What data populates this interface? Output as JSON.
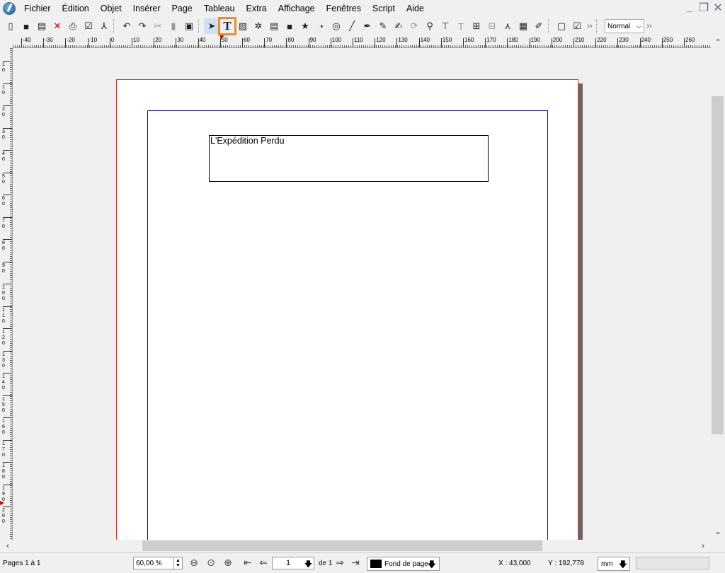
{
  "menu": [
    "Fichier",
    "Édition",
    "Objet",
    "Insérer",
    "Page",
    "Tableau",
    "Extra",
    "Affichage",
    "Fenêtres",
    "Script",
    "Aide"
  ],
  "toolbar": {
    "mode": "Normal",
    "icons": [
      "new-document-icon",
      "open-icon",
      "save-icon",
      "close-icon",
      "print-icon",
      "preflight-icon",
      "pdf-export-icon",
      "undo-icon",
      "redo-icon",
      "cut-icon",
      "copy-icon",
      "paste-icon",
      "select-icon",
      "text-frame-icon",
      "image-frame-icon",
      "render-frame-icon",
      "table-icon",
      "shape-icon",
      "polygon-icon",
      "arc-icon",
      "spiral-icon",
      "line-icon",
      "bezier-icon",
      "freehand-icon",
      "calligraphic-icon",
      "rotate-icon",
      "zoom-icon",
      "edit-content-icon",
      "edit-text-icon",
      "link-frames-icon",
      "unlink-frames-icon",
      "measure-icon",
      "copy-properties-icon",
      "eyedropper-icon",
      "pdf-pushbutton-icon",
      "pdf-checkbox-icon"
    ]
  },
  "rulers": {
    "h_labels": [
      "-40",
      "-30",
      "-20",
      "-10",
      "0",
      "10",
      "20",
      "30",
      "40",
      "50",
      "60",
      "70",
      "80",
      "90",
      "100",
      "110",
      "120",
      "130",
      "140",
      "150",
      "160",
      "170",
      "180",
      "190",
      "200",
      "210",
      "220",
      "230",
      "240",
      "250",
      "260"
    ],
    "v_labels": [
      "1 0",
      "1 0",
      "2 0",
      "3 0",
      "4 0",
      "5 0",
      "6 0",
      "7 0",
      "8 0",
      "9 0",
      "1 0 0",
      "1 1 0",
      "1 2 0",
      "1 3 0",
      "1 4 0",
      "1 5 0",
      "1 6 0",
      "1 7 0",
      "1 8 0",
      "1 9 0",
      "2 0 0"
    ]
  },
  "document": {
    "text_frame": "L'Expédition Perdu"
  },
  "status": {
    "pages": "Pages 1 à 1",
    "zoom": "60,00 %",
    "page_number": "1",
    "of_pages": "de 1",
    "layer": "Fond de page",
    "x": "X :  43,000",
    "y": "Y :  192,778",
    "unit": "mm"
  }
}
